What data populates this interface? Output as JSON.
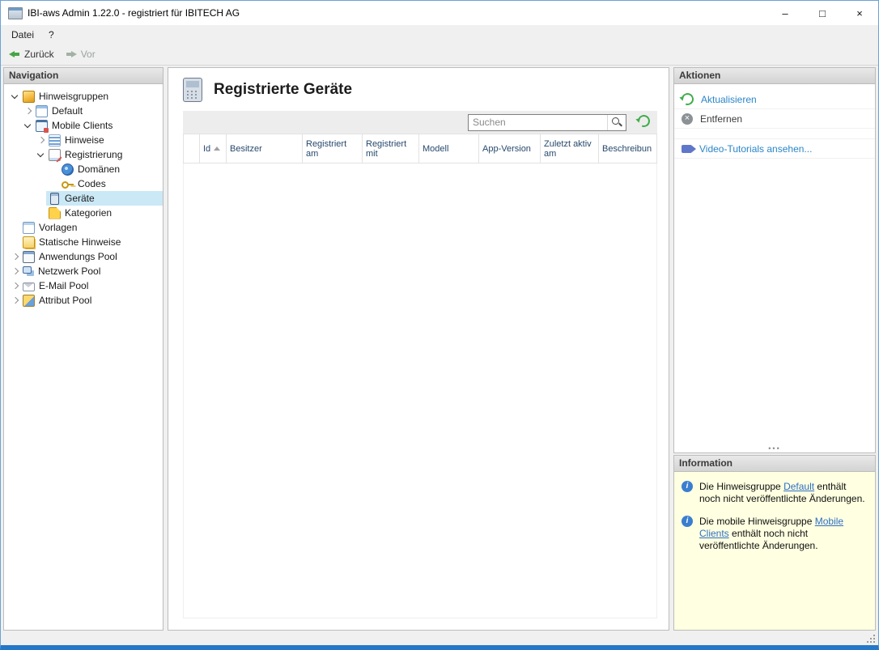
{
  "window": {
    "title": "IBI-aws Admin 1.22.0 - registriert für IBITECH AG",
    "controls": {
      "minimize": "–",
      "maximize": "□",
      "close": "×"
    }
  },
  "menubar": {
    "items": [
      "Datei",
      "?"
    ]
  },
  "toolbar": {
    "back_label": "Zurück",
    "forward_label": "Vor"
  },
  "navigation": {
    "header": "Navigation",
    "tree": [
      {
        "label": "Hinweisgruppen",
        "level": 0,
        "state": "expanded",
        "icon": "notice-groups-icon",
        "selected": false
      },
      {
        "label": "Default",
        "level": 1,
        "state": "collapsed",
        "icon": "default-group-icon",
        "selected": false
      },
      {
        "label": "Mobile Clients",
        "level": 1,
        "state": "expanded",
        "icon": "mobile-clients-icon",
        "selected": false
      },
      {
        "label": "Hinweise",
        "level": 2,
        "state": "collapsed",
        "icon": "notices-icon",
        "selected": false
      },
      {
        "label": "Registrierung",
        "level": 2,
        "state": "expanded",
        "icon": "registration-icon",
        "selected": false
      },
      {
        "label": "Domänen",
        "level": 3,
        "state": "leaf",
        "icon": "domains-icon",
        "selected": false
      },
      {
        "label": "Codes",
        "level": 3,
        "state": "leaf",
        "icon": "codes-key-icon",
        "selected": false
      },
      {
        "label": "Geräte",
        "level": 2,
        "state": "leaf",
        "icon": "devices-icon",
        "selected": true
      },
      {
        "label": "Kategorien",
        "level": 2,
        "state": "leaf",
        "icon": "categories-icon",
        "selected": false
      },
      {
        "label": "Vorlagen",
        "level": 0,
        "state": "leaf",
        "icon": "templates-icon",
        "selected": false
      },
      {
        "label": "Statische Hinweise",
        "level": 0,
        "state": "leaf",
        "icon": "static-notices-icon",
        "selected": false
      },
      {
        "label": "Anwendungs Pool",
        "level": 0,
        "state": "collapsed",
        "icon": "application-pool-icon",
        "selected": false
      },
      {
        "label": "Netzwerk Pool",
        "level": 0,
        "state": "collapsed",
        "icon": "network-pool-icon",
        "selected": false
      },
      {
        "label": "E-Mail Pool",
        "level": 0,
        "state": "collapsed",
        "icon": "email-pool-icon",
        "selected": false
      },
      {
        "label": "Attribut Pool",
        "level": 0,
        "state": "collapsed",
        "icon": "attribute-pool-icon",
        "selected": false
      }
    ]
  },
  "main": {
    "title": "Registrierte Geräte",
    "search_placeholder": "Suchen",
    "columns": [
      "Id",
      "Besitzer",
      "Registriert am",
      "Registriert mit",
      "Modell",
      "App-Version",
      "Zuletzt aktiv am",
      "Beschreibun"
    ],
    "sorted_column": "Id",
    "sort_direction": "asc",
    "rows": []
  },
  "actions": {
    "header": "Aktionen",
    "items": [
      {
        "label": "Aktualisieren",
        "icon": "refresh-icon",
        "style": "link"
      },
      {
        "label": "Entfernen",
        "icon": "remove-icon",
        "style": "plain"
      },
      {
        "label": "Video-Tutorials ansehen...",
        "icon": "video-icon",
        "style": "link"
      }
    ]
  },
  "information": {
    "header": "Information",
    "messages": [
      {
        "before": "Die Hinweisgruppe ",
        "link": "Default",
        "after": " enthält noch nicht veröffentlichte Änderungen."
      },
      {
        "before": "Die mobile Hinweisgruppe ",
        "link": "Mobile Clients",
        "after": " enthält noch nicht veröffentlichte Änderungen."
      }
    ]
  },
  "colors": {
    "accent_border": "#2577c8",
    "selection": "#cbe8f6",
    "info_background": "#ffffe1",
    "action_link": "#2b86c8"
  }
}
